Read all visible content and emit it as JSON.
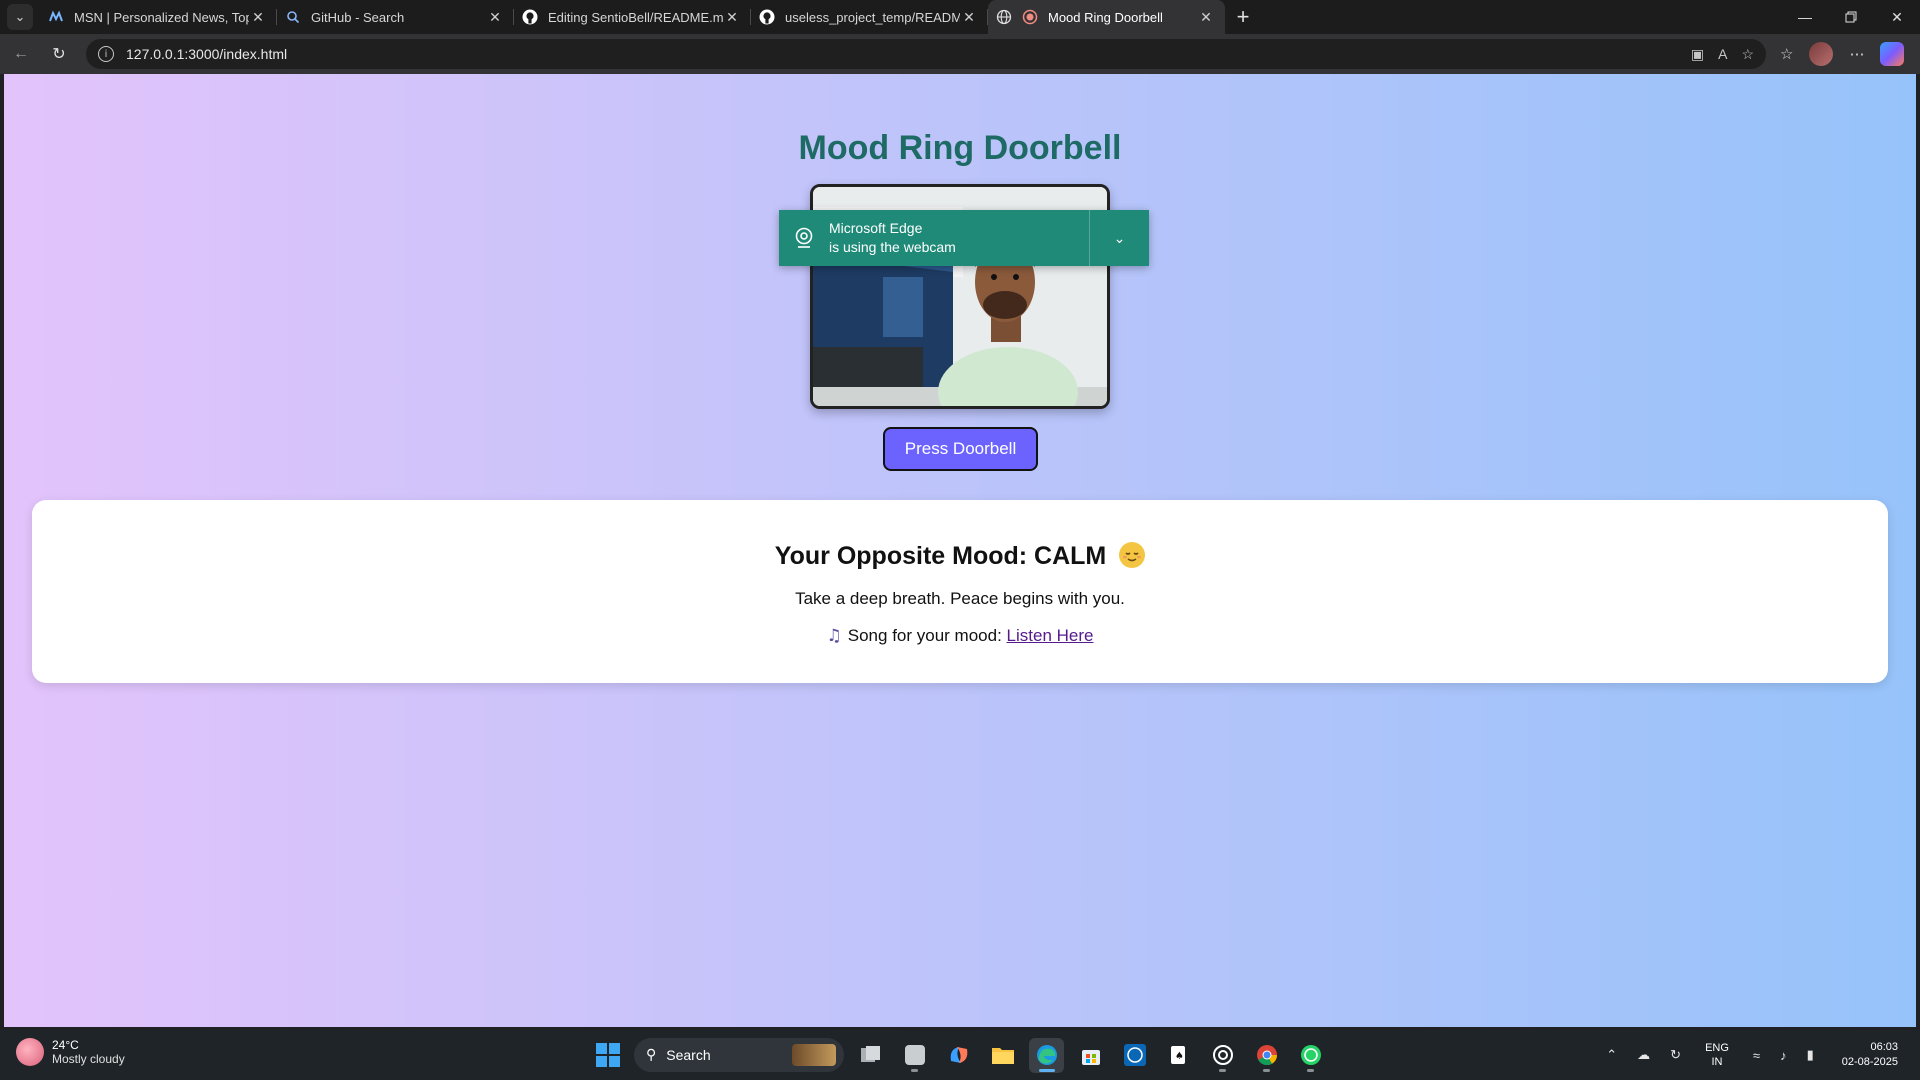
{
  "browser": {
    "tabs": [
      {
        "title": "MSN | Personalized News, Top He",
        "icon": "msn-icon",
        "active": false
      },
      {
        "title": "GitHub - Search",
        "icon": "search-icon",
        "active": false
      },
      {
        "title": "Editing SentioBell/README.md at",
        "icon": "github-icon",
        "active": false
      },
      {
        "title": "useless_project_temp/README.m",
        "icon": "github-icon",
        "active": false
      },
      {
        "title": "Mood Ring Doorbell",
        "icon": "globe-icon",
        "active": true
      }
    ],
    "address": "127.0.0.1:3000/index.html",
    "accent": "#1f8a78"
  },
  "webcam_notice": {
    "line1": "Microsoft Edge",
    "line2": "is using the webcam"
  },
  "page": {
    "title": "Mood Ring Doorbell",
    "doorbell_label": "Press Doorbell",
    "button_color": "#6c63ff",
    "mood": {
      "heading": "Your Opposite Mood: CALM",
      "message": "Take a deep breath. Peace begins with you.",
      "song_prefix": "Song for your mood:",
      "song_link": "Listen Here"
    }
  },
  "taskbar": {
    "weather_temp": "24°C",
    "weather_condition": "Mostly cloudy",
    "search_label": "Search",
    "lang_top": "ENG",
    "lang_bottom": "IN",
    "time": "06:03",
    "date": "02-08-2025"
  }
}
